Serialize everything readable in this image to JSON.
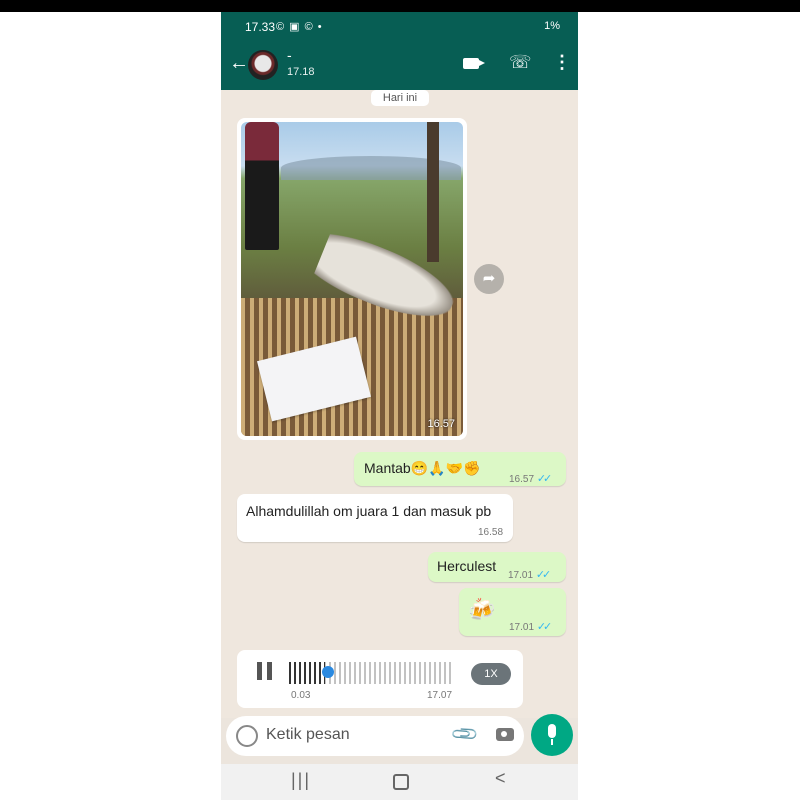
{
  "status_bar": {
    "time": "17.33",
    "left_icons": "© ▣ © •",
    "right_text": "1%"
  },
  "app_bar": {
    "back_icon": "←",
    "contact_name": "-",
    "last_seen": "17.18",
    "video_call_icon": "video-icon",
    "call_icon": "☏",
    "more_icon": "⋮"
  },
  "chat": {
    "date_chip": "Hari ini",
    "image_message": {
      "time": "16.57"
    },
    "forward_icon": "➦",
    "messages": [
      {
        "direction": "out",
        "text": "Mantab😁🙏🤝✊",
        "time": "16.57",
        "ticks": "✓✓"
      },
      {
        "direction": "in",
        "text": "Alhamdulillah om juara 1 dan masuk pb",
        "time": "16.58"
      },
      {
        "direction": "out",
        "text": "Herculest",
        "time": "17.01",
        "ticks": "✓✓"
      },
      {
        "direction": "out",
        "text": "🍻",
        "time": "17.01",
        "ticks": "✓✓"
      }
    ],
    "voice_note": {
      "position": "0.03",
      "duration": "17.07",
      "speed": "1X",
      "progress_fraction": 0.2
    }
  },
  "input_bar": {
    "placeholder": "Ketik pesan"
  },
  "nav_bar": {
    "recent": "|||",
    "back": "<"
  },
  "colors": {
    "header": "#075e54",
    "outgoing_bubble": "#dcf8c6",
    "chat_background": "#efe7de",
    "mic_button": "#00a884",
    "read_ticks": "#34b7f1"
  }
}
